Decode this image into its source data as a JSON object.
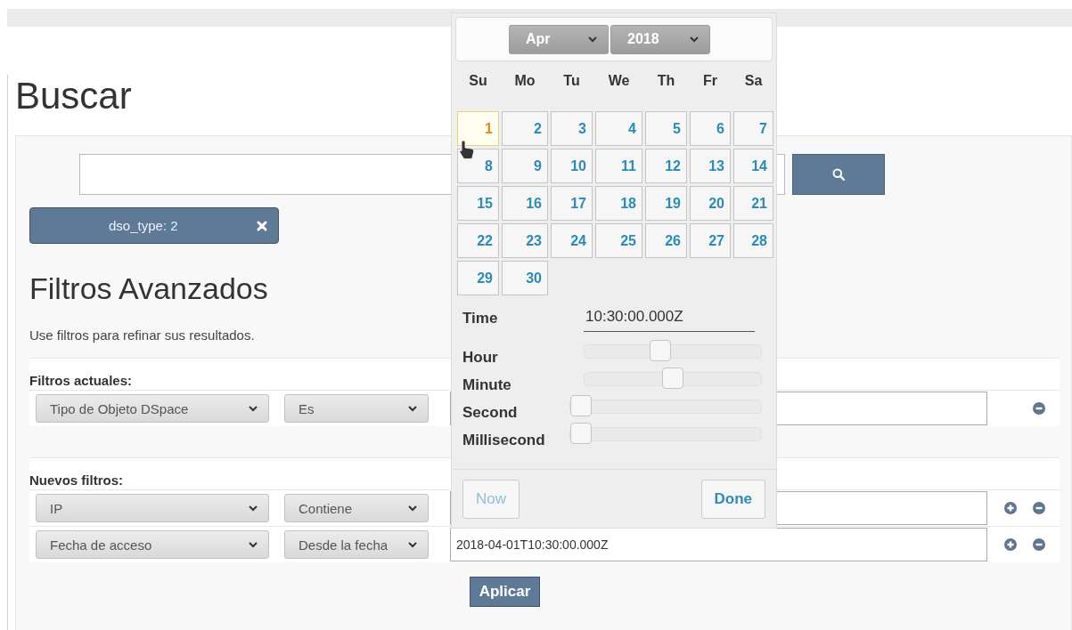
{
  "title": "Buscar",
  "tag": {
    "label": "dso_type: 2"
  },
  "advanced": {
    "title": "Filtros Avanzados",
    "description": "Use filtros para refinar sus resultados.",
    "current_label": "Filtros actuales:",
    "current_filters": [
      {
        "field": "Tipo de Objeto DSpace",
        "operator": "Es",
        "addable": false
      }
    ],
    "new_label": "Nuevos filtros:",
    "new_filters": [
      {
        "field": "IP",
        "operator": "Contiene",
        "addable": true
      },
      {
        "field": "Fecha de acceso",
        "operator": "Desde la fecha",
        "value": "2018-04-01T10:30:00.000Z",
        "addable": true
      }
    ],
    "apply_button": "Aplicar"
  },
  "datepicker": {
    "month": "Apr",
    "year": "2018",
    "weekdays": [
      "Su",
      "Mo",
      "Tu",
      "We",
      "Th",
      "Fr",
      "Sa"
    ],
    "days": [
      {
        "label": "1",
        "selected": true
      },
      {
        "label": "2",
        "selected": false
      },
      {
        "label": "3",
        "selected": false
      },
      {
        "label": "4",
        "selected": false
      },
      {
        "label": "5",
        "selected": false
      },
      {
        "label": "6",
        "selected": false
      },
      {
        "label": "7",
        "selected": false
      },
      {
        "label": "8",
        "selected": false
      },
      {
        "label": "9",
        "selected": false
      },
      {
        "label": "10",
        "selected": false
      },
      {
        "label": "11",
        "selected": false
      },
      {
        "label": "12",
        "selected": false
      },
      {
        "label": "13",
        "selected": false
      },
      {
        "label": "14",
        "selected": false
      },
      {
        "label": "15",
        "selected": false
      },
      {
        "label": "16",
        "selected": false
      },
      {
        "label": "17",
        "selected": false
      },
      {
        "label": "18",
        "selected": false
      },
      {
        "label": "19",
        "selected": false
      },
      {
        "label": "20",
        "selected": false
      },
      {
        "label": "21",
        "selected": false
      },
      {
        "label": "22",
        "selected": false
      },
      {
        "label": "23",
        "selected": false
      },
      {
        "label": "24",
        "selected": false
      },
      {
        "label": "25",
        "selected": false
      },
      {
        "label": "26",
        "selected": false
      },
      {
        "label": "27",
        "selected": false
      },
      {
        "label": "28",
        "selected": false
      },
      {
        "label": "29",
        "selected": false
      },
      {
        "label": "30",
        "selected": false
      }
    ],
    "time_label": "Time",
    "time_value": "10:30:00.000Z",
    "sliders": [
      {
        "label": "Hour",
        "level": 0.43
      },
      {
        "label": "Minute",
        "level": 0.51
      },
      {
        "label": "Second",
        "level": 0
      },
      {
        "label": "Millisecond",
        "level": 0
      }
    ],
    "now_button": {
      "label": "Now",
      "disabled": true
    },
    "done_button": {
      "label": "Done",
      "disabled": false
    }
  }
}
